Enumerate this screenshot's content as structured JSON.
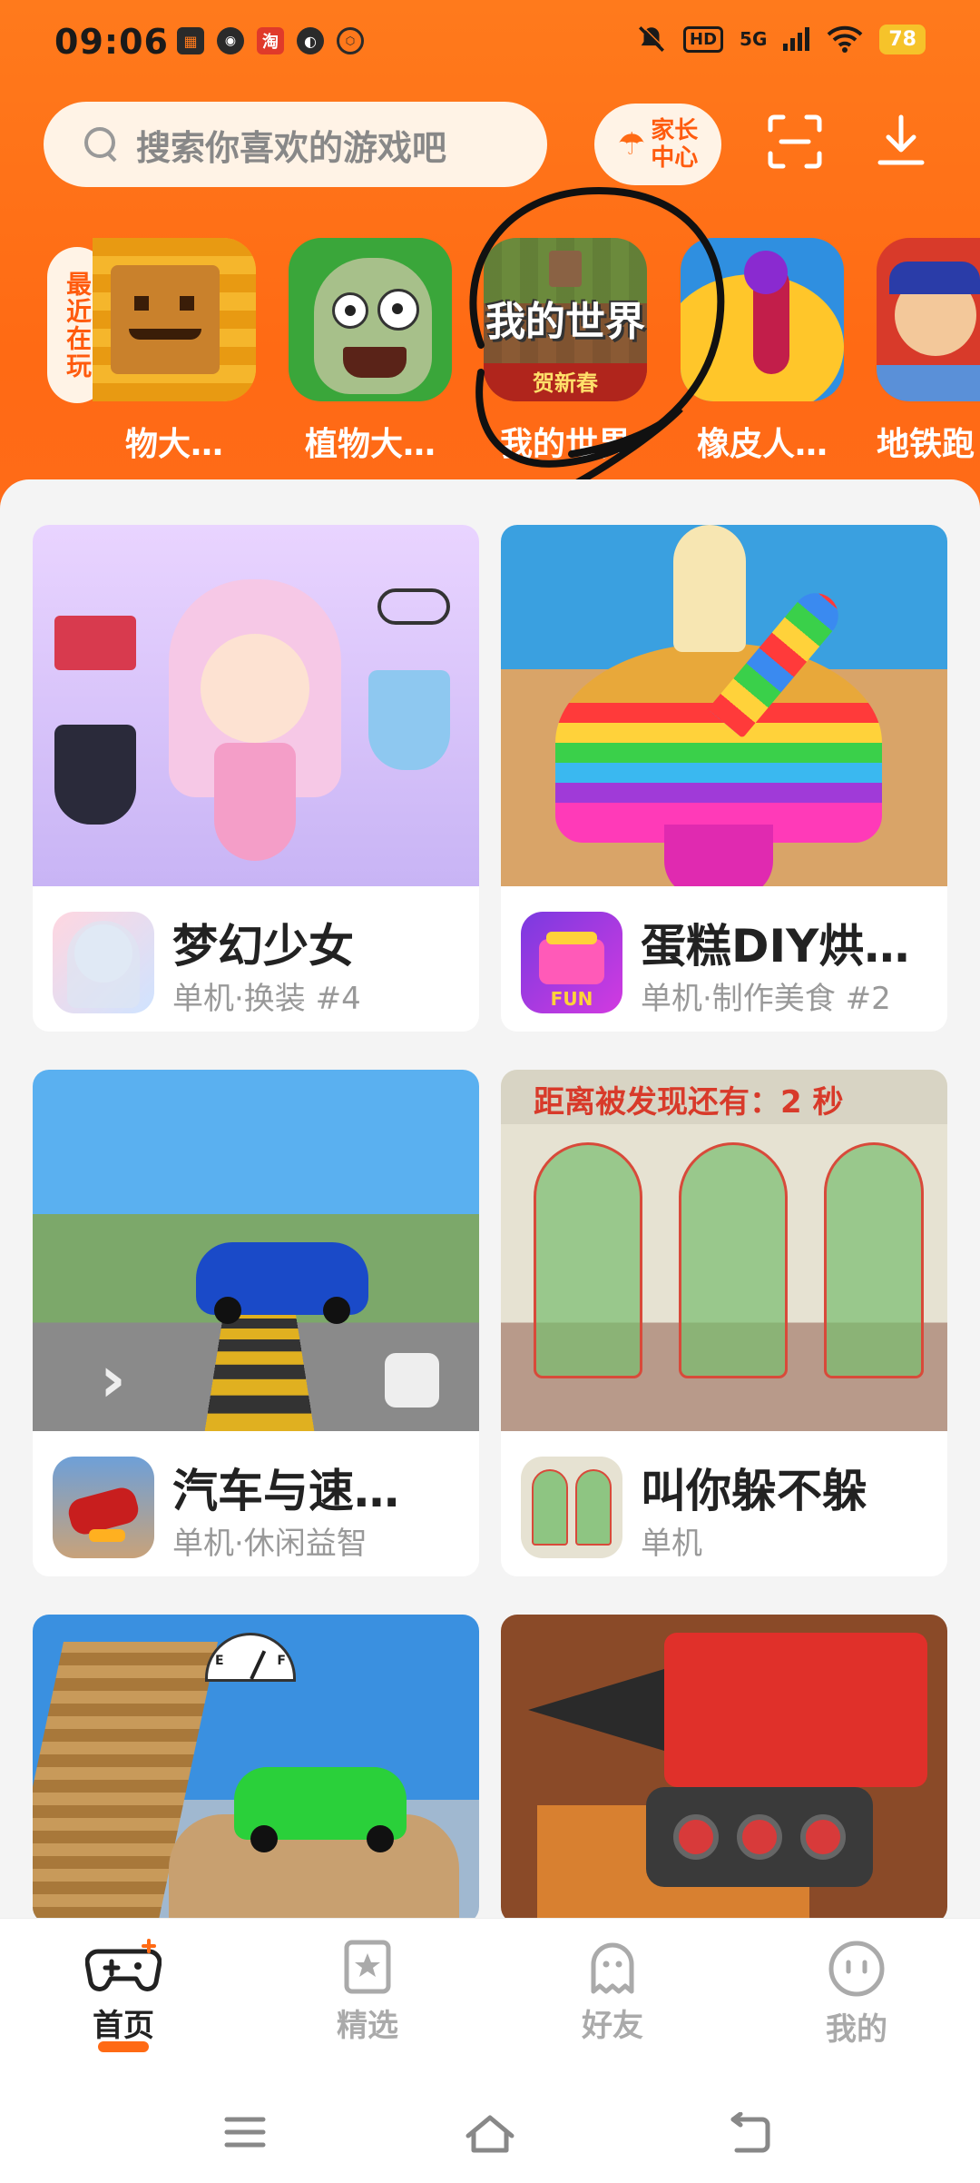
{
  "status_bar": {
    "time": "09:06",
    "hd": "HD",
    "network": "5G",
    "battery": "78",
    "taobao_icon": "淘"
  },
  "header": {
    "search_placeholder": "搜索你喜欢的游戏吧",
    "parent_center": "家长\n中心",
    "parent_line1": "家长",
    "parent_line2": "中心"
  },
  "recent": {
    "label": "最近在玩",
    "games": [
      {
        "name": "物大…",
        "icon": "sunflower-icon"
      },
      {
        "name": "植物大…",
        "icon": "zombie-icon"
      },
      {
        "name": "我的世界",
        "icon": "minecraft-icon",
        "tile_text": "我的世界",
        "tile_sub": "贺新春"
      },
      {
        "name": "橡皮人…",
        "icon": "rubber-man-icon"
      },
      {
        "name": "地铁跑",
        "icon": "subway-icon"
      }
    ]
  },
  "cards": [
    {
      "title": "梦幻少女",
      "sub": "单机·换装 #4"
    },
    {
      "title": "蛋糕DIY烘…",
      "sub": "单机·制作美食 #2",
      "icon_text": "FUN"
    },
    {
      "title": "汽车与速…",
      "sub": "单机·休闲益智"
    },
    {
      "title": "叫你躲不躲",
      "sub": "单机",
      "img_text": "距离被发现还有：2 秒"
    },
    {
      "title": "",
      "sub": ""
    },
    {
      "title": "",
      "sub": ""
    }
  ],
  "fuel_gauge": {
    "e": "E",
    "f": "F"
  },
  "bottom_nav": [
    {
      "label": "首页",
      "icon": "gamepad-icon",
      "active": true
    },
    {
      "label": "精选",
      "icon": "star-bookmark-icon",
      "active": false
    },
    {
      "label": "好友",
      "icon": "ghost-icon",
      "active": false
    },
    {
      "label": "我的",
      "icon": "smiley-icon",
      "active": false
    }
  ],
  "colors": {
    "brand_orange": "#ff6a14",
    "bg": "#f4f4f4"
  }
}
